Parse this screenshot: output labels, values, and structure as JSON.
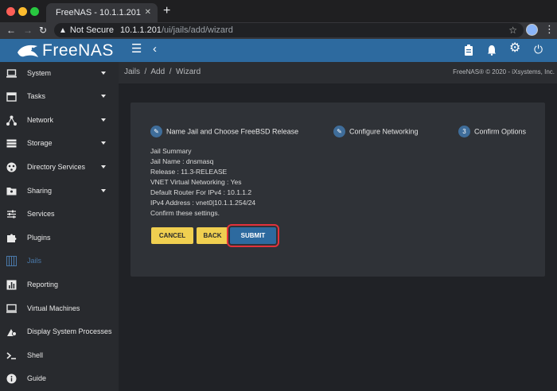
{
  "browser": {
    "tab_title": "FreeNAS - 10.1.1.201",
    "tab_close": "✕",
    "new_tab": "+",
    "security_label": "Not Secure",
    "url_host": "10.1.1.201",
    "url_path": "/ui/jails/add/wizard"
  },
  "app": {
    "logo_text": "FreeNAS",
    "breadcrumb": "Jails  /  Add  /  Wizard",
    "copyright": "FreeNAS® © 2020 - iXsystems, Inc."
  },
  "sidebar": {
    "items": [
      {
        "label": "System",
        "icon": "laptop-icon",
        "has_caret": true
      },
      {
        "label": "Tasks",
        "icon": "calendar-icon",
        "has_caret": true
      },
      {
        "label": "Network",
        "icon": "network-icon",
        "has_caret": true
      },
      {
        "label": "Storage",
        "icon": "storage-icon",
        "has_caret": true
      },
      {
        "label": "Directory Services",
        "icon": "directory-icon",
        "has_caret": true
      },
      {
        "label": "Sharing",
        "icon": "folder-share-icon",
        "has_caret": true
      },
      {
        "label": "Services",
        "icon": "sliders-icon",
        "has_caret": false
      },
      {
        "label": "Plugins",
        "icon": "puzzle-icon",
        "has_caret": false
      },
      {
        "label": "Jails",
        "icon": "jail-icon",
        "has_caret": false,
        "active": true
      },
      {
        "label": "Reporting",
        "icon": "chart-icon",
        "has_caret": false
      },
      {
        "label": "Virtual Machines",
        "icon": "monitor-icon",
        "has_caret": false
      },
      {
        "label": "Display System Processes",
        "icon": "processes-icon",
        "has_caret": false
      },
      {
        "label": "Shell",
        "icon": "terminal-icon",
        "has_caret": false
      },
      {
        "label": "Guide",
        "icon": "info-icon",
        "has_caret": false
      }
    ]
  },
  "wizard": {
    "steps": [
      {
        "label": "Name Jail and Choose FreeBSD Release",
        "icon": "pencil-icon",
        "glyph": "✎"
      },
      {
        "label": "Configure Networking",
        "icon": "pencil-icon",
        "glyph": "✎"
      },
      {
        "label": "Confirm Options",
        "icon": "step-number-icon",
        "glyph": "3"
      }
    ],
    "summary": {
      "heading": "Jail Summary",
      "jail_name": "Jail Name : dnsmasq",
      "release": "Release : 11.3-RELEASE",
      "vnet": "VNET Virtual Networking : Yes",
      "router": "Default Router For IPv4 : 10.1.1.2",
      "ipv4": "IPv4 Address : vnet0|10.1.1.254/24",
      "confirm": "Confirm these settings."
    },
    "buttons": {
      "cancel": "CANCEL",
      "back": "BACK",
      "submit": "SUBMIT"
    }
  },
  "colors": {
    "accent": "#2d6a9f",
    "button_yellow": "#f0cf50",
    "highlight_red": "#e3323b"
  }
}
